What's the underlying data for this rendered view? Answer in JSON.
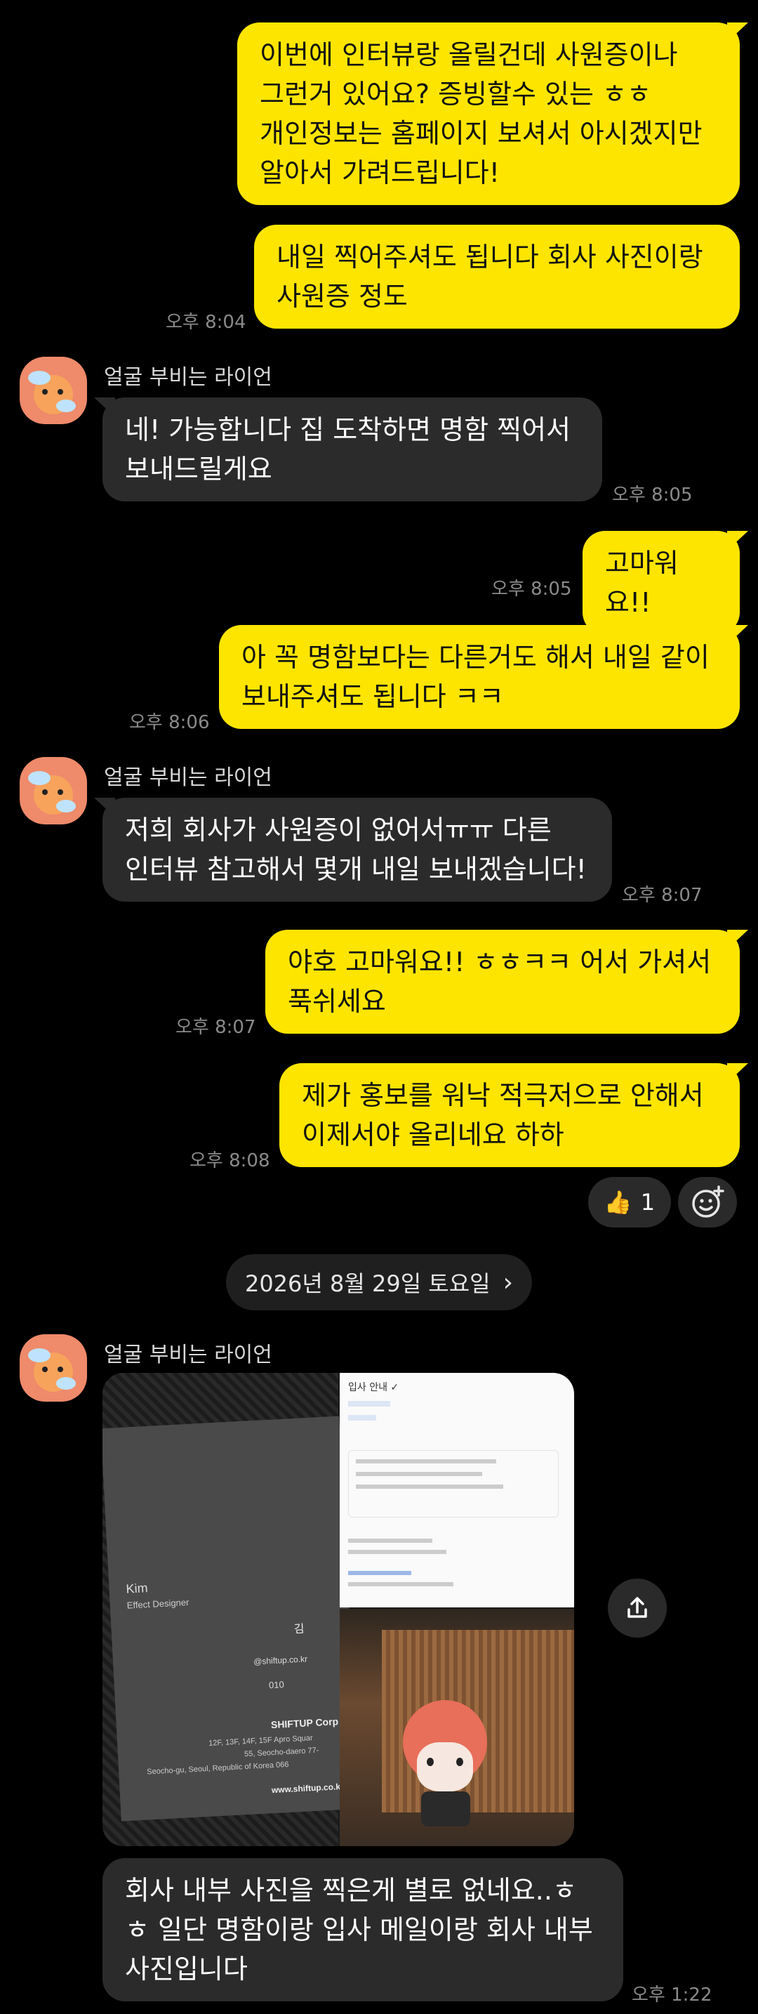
{
  "messages": [
    {
      "text": "이번에 인터뷰랑 올릴건데 사원증이나\n그런거 있어요? 증빙할수 있는 ㅎㅎ\n개인정보는 홈페이지 보셔서 아시겠지만\n알아서 가려드립니다!"
    },
    {
      "text": "내일 찍어주셔도 됩니다 회사 사진이랑\n사원증 정도",
      "time": "오후 8:04"
    },
    {
      "text": "네! 가능합니다 집 도착하면 명함 찍어서\n보내드릴게요",
      "time": "오후 8:05",
      "sender": "얼굴 부비는 라이언"
    },
    {
      "text": "고마워요!!",
      "time": "오후 8:05"
    },
    {
      "text": "아 꼭 명함보다는 다른거도 해서 내일 같이\n보내주셔도 됩니다 ㅋㅋ",
      "time": "오후 8:06"
    },
    {
      "text": "저희 회사가 사원증이 없어서ㅠㅠ 다른\n인터뷰 참고해서 몇개 내일 보내겠습니다!",
      "time": "오후 8:07",
      "sender": "얼굴 부비는 라이언"
    },
    {
      "text": "야호 고마워요!! ㅎㅎㅋㅋ 어서 가셔서\n푹쉬세요",
      "time": "오후 8:07"
    },
    {
      "text": "제가 홍보를 워낙 적극저으로 안해서\n이제서야 올리네요 하하",
      "time": "오후 8:08"
    },
    {
      "text": "회사 내부 사진을 찍은게 별로 없네요..ㅎ\nㅎ 일단 명함이랑 입사 메일이랑 회사 내부\n사진입니다",
      "time": "오후 1:22",
      "sender": "얼굴 부비는 라이언"
    }
  ],
  "reaction": {
    "emoji": "👍",
    "count": "1"
  },
  "date_divider": {
    "label": "2026년 8월 29일 토요일",
    "chevron": "›"
  },
  "photo_sender": "얼굴 부비는 라이언",
  "business_card": {
    "name_en": "Kim",
    "role": "Effect Designer",
    "name_ko": "김",
    "email_fragment": "@shiftup.co.kr",
    "phone_prefix": "010",
    "company": "SHIFTUP Corp",
    "addr1": "12F, 13F, 14F, 15F Apro Squar",
    "addr2": "55, Seocho-daero 77-",
    "addr3": "Seocho-gu, Seoul, Republic of Korea 066",
    "website": "www.shiftup.co.kr"
  },
  "email_preview": {
    "title": "입사 안내 ✓"
  },
  "colors": {
    "my_bubble": "#FEE500",
    "other_bubble": "#2b2b2b",
    "background": "#000000"
  }
}
